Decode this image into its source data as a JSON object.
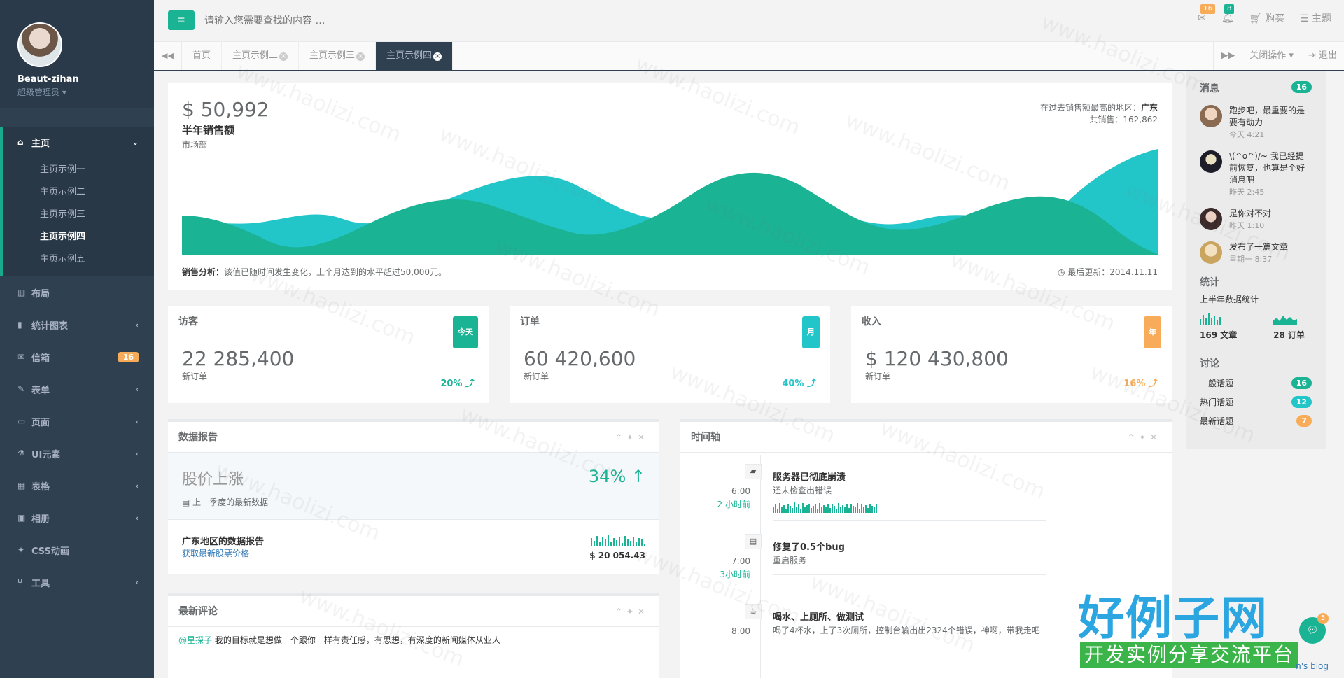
{
  "sidebar": {
    "user_name": "Beaut-zihan",
    "user_role": "超级管理员",
    "main_label": "主页",
    "sub_items": [
      "主页示例一",
      "主页示例二",
      "主页示例三",
      "主页示例四",
      "主页示例五"
    ],
    "items": [
      {
        "label": "布局",
        "icon": "columns-icon"
      },
      {
        "label": "统计图表",
        "icon": "bar-chart-icon"
      },
      {
        "label": "信箱",
        "icon": "envelope-icon",
        "badge": "16"
      },
      {
        "label": "表单",
        "icon": "edit-icon"
      },
      {
        "label": "页面",
        "icon": "desktop-icon"
      },
      {
        "label": "UI元素",
        "icon": "flask-icon"
      },
      {
        "label": "表格",
        "icon": "table-icon"
      },
      {
        "label": "相册",
        "icon": "picture-icon"
      },
      {
        "label": "CSS动画",
        "icon": "magic-icon"
      },
      {
        "label": "工具",
        "icon": "cutlery-icon"
      }
    ]
  },
  "topbar": {
    "search_placeholder": "请输入您需要查找的内容 …",
    "mail_count": "16",
    "bell_count": "8",
    "buy_label": "购买",
    "theme_label": "主题"
  },
  "tabs": {
    "items": [
      "首页",
      "主页示例二",
      "主页示例三",
      "主页示例四"
    ],
    "close_ops": "关闭操作",
    "logout": "退出"
  },
  "sales": {
    "amount": "$ 50,992",
    "title": "半年销售额",
    "dept": "市场部",
    "region_label": "在过去销售额最高的地区：",
    "region": "广东",
    "total_label": "共销售：",
    "total": "162,862",
    "analysis_label": "销售分析：",
    "analysis_text": "该值已随时间发生变化，上个月达到的水平超过50,000元。",
    "updated": "最后更新：2014.11.11"
  },
  "stats": [
    {
      "title": "访客",
      "tag": "今天",
      "value": "22 285,400",
      "sub": "新订单",
      "pct": "20%",
      "color": "#1ab394"
    },
    {
      "title": "订单",
      "tag": "月",
      "value": "60 420,600",
      "sub": "新订单",
      "pct": "40%",
      "color": "#23c6c8"
    },
    {
      "title": "收入",
      "tag": "年",
      "value": "$ 120 430,800",
      "sub": "新订单",
      "pct": "16%",
      "color": "#f8ac59"
    }
  ],
  "report": {
    "title": "数据报告",
    "headline": "股价上涨",
    "pct": "34%",
    "sub": "上一季度的最新数据",
    "row_title": "广东地区的数据报告",
    "row_link": "获取最新股票价格",
    "row_money": "$ 20 054.43"
  },
  "comments": {
    "title": "最新评论",
    "user": "@星探子",
    "text": "我的目标就是想做一个跟你一样有责任感，有思想，有深度的新闻媒体从业人"
  },
  "timeline": {
    "title": "时间轴",
    "items": [
      {
        "time": "6:00",
        "ago": "2 小时前",
        "title": "服务器已彻底崩溃",
        "desc": "还未检查出错误",
        "icon": "briefcase-icon"
      },
      {
        "time": "7:00",
        "ago": "3小时前",
        "title": "修复了0.5个bug",
        "desc": "重启服务",
        "icon": "file-icon"
      },
      {
        "time": "8:00",
        "ago": "",
        "title": "喝水、上厕所、做测试",
        "desc": "喝了4杯水，上了3次厕所，控制台输出出2324个错误，神啊，带我走吧",
        "icon": "coffee-icon"
      }
    ]
  },
  "rightbar": {
    "messages_title": "消息",
    "messages_count": "16",
    "messages": [
      {
        "text": "跑步吧，最重要的是要有动力",
        "time": "今天 4:21"
      },
      {
        "text": "\\(^o^)/~ 我已经提前恢复，也算是个好消息吧",
        "time": "昨天 2:45"
      },
      {
        "text": "是你对不对",
        "time": "昨天 1:10"
      },
      {
        "text": "发布了一篇文章",
        "time": "星期一 8:37"
      }
    ],
    "stats_title": "统计",
    "stats_sub": "上半年数据统计",
    "articles": "169 文章",
    "orders": "28 订单",
    "discuss_title": "讨论",
    "discuss": [
      {
        "label": "一般话题",
        "count": "16"
      },
      {
        "label": "热门话题",
        "count": "12"
      },
      {
        "label": "最新话题",
        "count": "7"
      }
    ]
  },
  "footer": {
    "brand_big": "好例子网",
    "brand_small": "开发实例分享交流平台",
    "chat_count": "5",
    "blog": "n's blog",
    "watermark": "www.haolizi.com"
  }
}
